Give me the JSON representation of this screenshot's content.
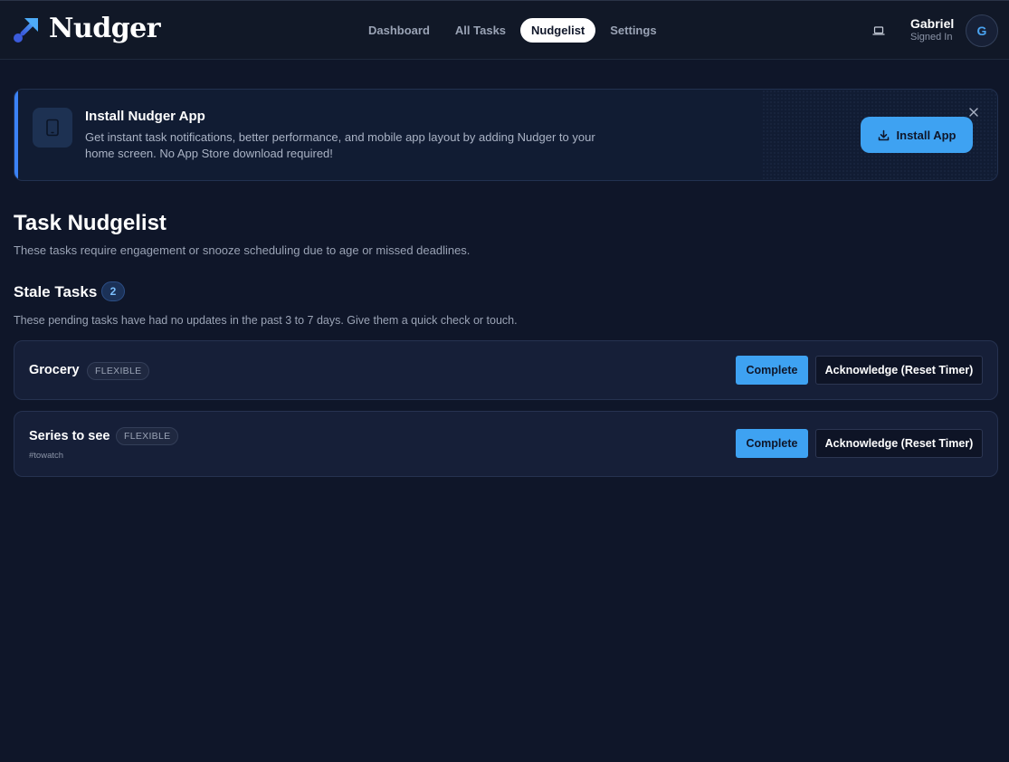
{
  "header": {
    "app_name": "Nudger",
    "logo_icon": "arrow-up-right-icon",
    "nav": [
      {
        "label": "Dashboard",
        "active": false
      },
      {
        "label": "All Tasks",
        "active": false
      },
      {
        "label": "Nudgelist",
        "active": true
      },
      {
        "label": "Settings",
        "active": false
      }
    ],
    "device_icon": "laptop-icon",
    "user": {
      "name": "Gabriel",
      "status": "Signed In",
      "initial": "G"
    }
  },
  "banner": {
    "title": "Install Nudger App",
    "description": "Get instant task notifications, better performance, and mobile app layout by adding Nudger to your home screen. No App Store download required!",
    "button_label": "Install App",
    "icon": "tablet-icon",
    "close_icon": "close-icon"
  },
  "page": {
    "title": "Task Nudgelist",
    "subtitle": "These tasks require engagement or snooze scheduling due to age or missed deadlines."
  },
  "stale_section": {
    "title": "Stale Tasks",
    "count": "2",
    "description": "These pending tasks have had no updates in the past 3 to 7 days. Give them a quick check or touch."
  },
  "tasks": [
    {
      "name": "Grocery",
      "type": "FLEXIBLE",
      "tag": "",
      "complete_label": "Complete",
      "ack_label": "Acknowledge (Reset Timer)"
    },
    {
      "name": "Series to see",
      "type": "FLEXIBLE",
      "tag": "#towatch",
      "complete_label": "Complete",
      "ack_label": "Acknowledge (Reset Timer)"
    }
  ],
  "colors": {
    "background": "#0f1629",
    "accent": "#3ea2f2",
    "card": "#161f38"
  }
}
